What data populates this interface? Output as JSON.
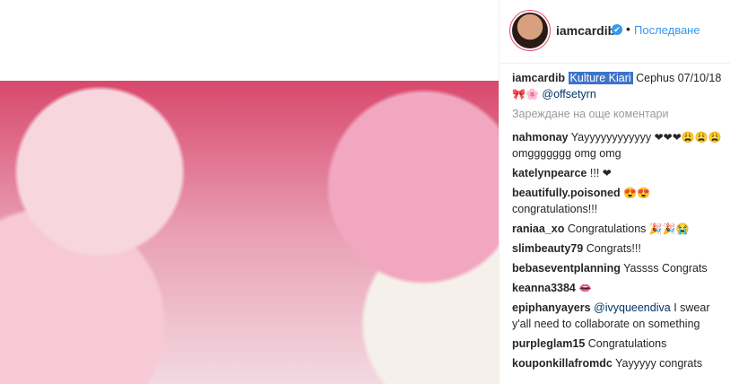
{
  "post": {
    "username": "iamcardib",
    "verified_mark": "✔",
    "dot": "•",
    "follow_label": "Последване"
  },
  "caption": {
    "username": "iamcardib",
    "highlighted": "Kulture Kiari",
    "rest": "Cephus 07/10/18",
    "emojis": "🎀🌸",
    "mention": "@offsetyrn"
  },
  "load_more": "Зареждане на още коментари",
  "comments": [
    {
      "user": "nahmonay",
      "text": "Yayyyyyyyyyyyy",
      "emoji": "❤❤❤😩😩😩",
      "text2": "omggggggg omg omg"
    },
    {
      "user": "katelynpearce",
      "text": "!!!",
      "emoji": "❤"
    },
    {
      "user": "beautifully.poisoned",
      "text": "",
      "emoji": "😍😍",
      "text2": "congratulations!!!"
    },
    {
      "user": "raniaa_xo",
      "text": "Congratulations",
      "emoji": "🎉🎉😭"
    },
    {
      "user": "slimbeauty79",
      "text": "Congrats!!!"
    },
    {
      "user": "bebaseventplanning",
      "text": "Yassss Congrats"
    },
    {
      "user": "keanna3384",
      "text": "",
      "emoji": "👄"
    },
    {
      "user": "epiphanyayers",
      "mention": "@ivyqueendiva",
      "text": "I swear y'all need to collaborate on something"
    },
    {
      "user": "purpleglam15",
      "text": "Congratulations"
    },
    {
      "user": "kouponkillafromdc",
      "text": "Yayyyyy congrats"
    }
  ]
}
